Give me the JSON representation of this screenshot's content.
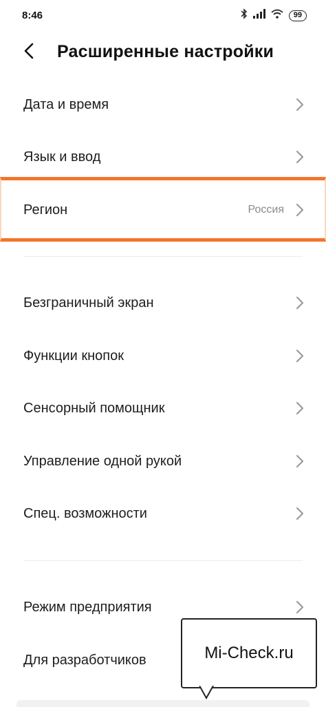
{
  "status_bar": {
    "time": "8:46",
    "battery": "99"
  },
  "header": {
    "title": "Расширенные настройки"
  },
  "rows": [
    {
      "label": "Дата и время",
      "value": ""
    },
    {
      "label": "Язык и ввод",
      "value": ""
    },
    {
      "label": "Регион",
      "value": "Россия"
    },
    {
      "label": "Безграничный экран",
      "value": ""
    },
    {
      "label": "Функции кнопок",
      "value": ""
    },
    {
      "label": "Сенсорный помощник",
      "value": ""
    },
    {
      "label": "Управление одной рукой",
      "value": ""
    },
    {
      "label": "Спец. возможности",
      "value": ""
    },
    {
      "label": "Режим предприятия",
      "value": ""
    },
    {
      "label": "Для разработчиков",
      "value": ""
    }
  ],
  "watermark": {
    "text": "Mi-Check.ru"
  },
  "colors": {
    "highlight": "#f4752a",
    "chevron": "#9a9a9a"
  }
}
